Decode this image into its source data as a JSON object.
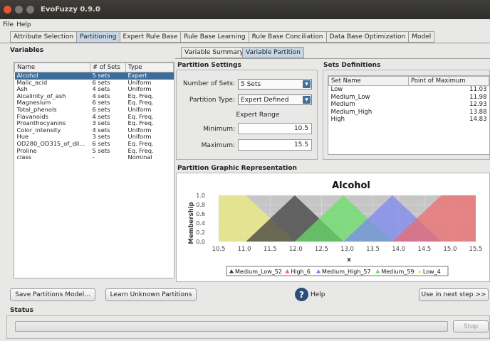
{
  "window": {
    "title": "EvoFuzzy 0.9.0"
  },
  "menu": [
    "File",
    "Help"
  ],
  "tabs": [
    "Attribute Selection",
    "Partitioning",
    "Expert Rule Base",
    "Rule Base Learning",
    "Rule Base Conciliation",
    "Data Base Optimization",
    "Model"
  ],
  "active_tab": 1,
  "subtabs": [
    "Variable Summary",
    "Variable Partition"
  ],
  "active_subtab": 1,
  "variables": {
    "heading": "Variables",
    "columns": [
      "Name",
      "# of Sets",
      "Type"
    ],
    "rows": [
      [
        "Alcohol",
        "5 sets",
        "Expert"
      ],
      [
        "Malic_acid",
        "6 sets",
        "Uniform"
      ],
      [
        "Ash",
        "4 sets",
        "Uniform"
      ],
      [
        "Alcalinity_of_ash",
        "4 sets",
        "Eq. Freq."
      ],
      [
        "Magnesium",
        "6 sets",
        "Eq. Freq."
      ],
      [
        "Total_phenols",
        "6 sets",
        "Uniform"
      ],
      [
        "Flavanoids",
        "4 sets",
        "Eq. Freq."
      ],
      [
        "Proanthocyanins",
        "3 sets",
        "Eq. Freq."
      ],
      [
        "Color_intensity",
        "4 sets",
        "Uniform"
      ],
      [
        "Hue",
        "3 sets",
        "Uniform"
      ],
      [
        "OD280_OD315_of_dil...",
        "6 sets",
        "Eq. Freq."
      ],
      [
        "Proline",
        "5 sets",
        "Eq. Freq."
      ],
      [
        "class",
        "-",
        "Nominal"
      ]
    ],
    "selected": 0
  },
  "partition_settings": {
    "heading": "Partition Settings",
    "num_sets_label": "Number of Sets:",
    "num_sets_value": "5 Sets",
    "type_label": "Partition Type:",
    "type_value": "Expert Defined",
    "range_label": "Expert Range",
    "min_label": "Minimum:",
    "min_value": "10.5",
    "max_label": "Maximum:",
    "max_value": "15.5"
  },
  "sets_definitions": {
    "heading": "Sets Definitions",
    "columns": [
      "Set Name",
      "Point of Maximum"
    ],
    "rows": [
      [
        "Low",
        "11.03"
      ],
      [
        "Medium_Low",
        "11.98"
      ],
      [
        "Medium",
        "12.93"
      ],
      [
        "Medium_High",
        "13.88"
      ],
      [
        "High",
        "14.83"
      ]
    ]
  },
  "graph": {
    "heading": "Partition Graphic Representation",
    "chart_data": {
      "type": "area",
      "title": "Alcohol",
      "xlabel": "x",
      "ylabel": "Membership",
      "xlim": [
        10.5,
        15.5
      ],
      "ylim": [
        0,
        1.0
      ],
      "xticks": [
        "10.5",
        "11.0",
        "11.5",
        "12.0",
        "12.5",
        "13.0",
        "13.5",
        "14.0",
        "14.5",
        "15.0",
        "15.5"
      ],
      "yticks": [
        "0.0",
        "0.2",
        "0.4",
        "0.6",
        "0.8",
        "1.0"
      ],
      "series": [
        {
          "name": "Low_4",
          "color": "#eeee7e",
          "points": [
            [
              10.5,
              1
            ],
            [
              11.03,
              1
            ],
            [
              11.98,
              0
            ]
          ]
        },
        {
          "name": "Medium_Low_52",
          "color": "#3a3a3a",
          "points": [
            [
              11.03,
              0
            ],
            [
              11.98,
              1
            ],
            [
              12.93,
              0
            ]
          ]
        },
        {
          "name": "Medium_59",
          "color": "#66e066",
          "points": [
            [
              11.98,
              0
            ],
            [
              12.93,
              1
            ],
            [
              13.88,
              0
            ]
          ]
        },
        {
          "name": "Medium_High_57",
          "color": "#7a86f0",
          "points": [
            [
              12.93,
              0
            ],
            [
              13.88,
              1
            ],
            [
              14.83,
              0
            ]
          ]
        },
        {
          "name": "High_6",
          "color": "#f06a6a",
          "points": [
            [
              13.88,
              0
            ],
            [
              14.83,
              1
            ],
            [
              15.5,
              1
            ]
          ]
        }
      ],
      "legend": [
        {
          "name": "Medium_Low_52",
          "color": "#3a3a3a"
        },
        {
          "name": "High_6",
          "color": "#f06a6a"
        },
        {
          "name": "Medium_High_57",
          "color": "#7a86f0"
        },
        {
          "name": "Medium_59",
          "color": "#66e066"
        },
        {
          "name": "Low_4",
          "color": "#eeee7e"
        }
      ]
    }
  },
  "buttons": {
    "save": "Save Partitions Model...",
    "learn": "Learn Unknown Partitions",
    "help": "Help",
    "next": "Use in next step >>",
    "stop": "Stop"
  },
  "status": {
    "heading": "Status"
  }
}
